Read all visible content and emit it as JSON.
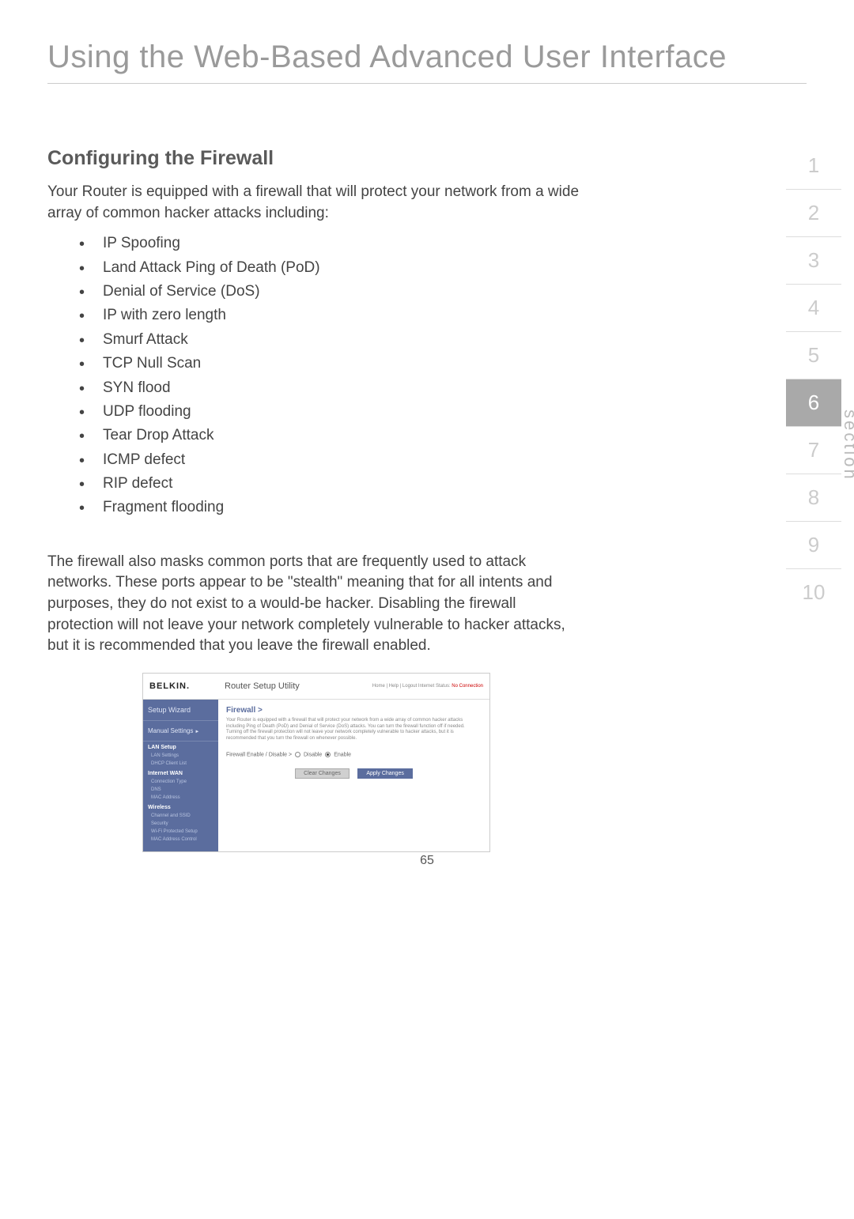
{
  "mainTitle": "Using the Web-Based Advanced User Interface",
  "subtitle": "Configuring the Firewall",
  "intro": "Your Router is equipped with a firewall that will protect your network from a wide array of common hacker attacks including:",
  "attacks": [
    "IP Spoofing",
    "Land Attack Ping of Death (PoD)",
    "Denial of Service (DoS)",
    "IP with zero length",
    "Smurf Attack",
    "TCP Null Scan",
    "SYN flood",
    "UDP flooding",
    "Tear Drop Attack",
    "ICMP defect",
    "RIP defect",
    "Fragment flooding"
  ],
  "para2": "The firewall also masks common ports that are frequently used to attack networks. These ports appear to be \"stealth\" meaning that for all intents and purposes, they do not exist to a would-be hacker. Disabling the firewall protection will not leave your network completely vulnerable to hacker attacks, but it is recommended that you leave the firewall enabled.",
  "sectionNumbers": [
    "1",
    "2",
    "3",
    "4",
    "5",
    "6",
    "7",
    "8",
    "9",
    "10"
  ],
  "activeSection": "6",
  "sectionLabel": "section",
  "pageNumber": "65",
  "screenshot": {
    "logo": "BELKIN.",
    "utilityTitle": "Router Setup Utility",
    "topLinks": "Home | Help | Logout   Internet Status:",
    "topLinkStatus": "No Connection",
    "sidebar": {
      "wizard": "Setup Wizard",
      "manual": "Manual Settings",
      "groups": [
        {
          "title": "LAN Setup",
          "items": [
            "LAN Settings",
            "DHCP Client List"
          ]
        },
        {
          "title": "Internet WAN",
          "items": [
            "Connection Type",
            "DNS",
            "MAC Address"
          ]
        },
        {
          "title": "Wireless",
          "items": [
            "Channel and SSID",
            "Security",
            "Wi-Fi Protected Setup",
            "MAC Address Control"
          ]
        }
      ]
    },
    "main": {
      "title": "Firewall >",
      "desc": "Your Router is equipped with a firewall that will protect your network from a wide array of common hacker attacks including Ping of Death (PoD) and Denial of Service (DoS) attacks. You can turn the firewall function off if needed. Turning off the firewall protection will not leave your network completely vulnerable to hacker attacks, but it is recommended that you turn the firewall on whenever possible.",
      "rowLabel": "Firewall Enable / Disable >",
      "opt1": "Disable",
      "opt2": "Enable",
      "btnClear": "Clear Changes",
      "btnApply": "Apply Changes"
    }
  }
}
